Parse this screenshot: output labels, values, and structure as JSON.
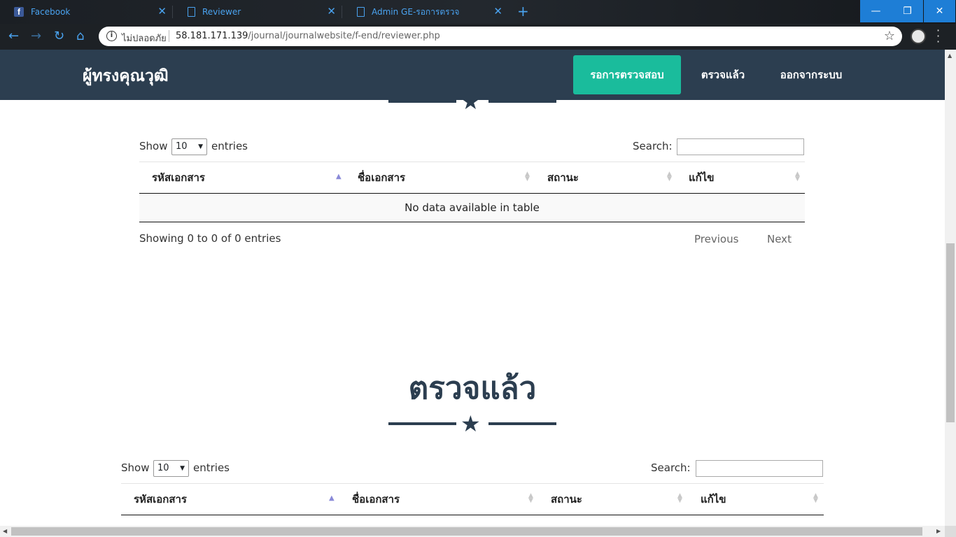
{
  "browser": {
    "tabs": [
      {
        "title": "Facebook",
        "icon": "facebook-icon"
      },
      {
        "title": "Reviewer",
        "icon": "document-icon"
      },
      {
        "title": "Admin GE-รอการตรวจ",
        "icon": "document-icon"
      }
    ],
    "new_tab": "+",
    "insecure_label": "ไม่ปลอดภัย",
    "url_host": "58.181.171.139",
    "url_path": "/journal/journalwebsite/f-end/reviewer.php"
  },
  "navbar": {
    "brand": "ผู้ทรงคุณวุฒิ",
    "items": [
      {
        "label": "รอการตรวจสอบ",
        "active": true
      },
      {
        "label": "ตรวจแล้ว",
        "active": false
      },
      {
        "label": "ออกจากระบบ",
        "active": false
      }
    ]
  },
  "section2": {
    "title": "ตรวจแล้ว"
  },
  "table": {
    "show_label": "Show",
    "entries_label": "entries",
    "page_size": "10",
    "search_label": "Search:",
    "columns": [
      "รหัสเอกสาร",
      "ชื่อเอกสาร",
      "สถานะ",
      "แก้ไข"
    ],
    "empty_message": "No data available in table",
    "info": "Showing 0 to 0 of 0 entries",
    "previous": "Previous",
    "next": "Next"
  },
  "colors": {
    "navbar": "#2c3e50",
    "accent": "#1abc9c"
  }
}
